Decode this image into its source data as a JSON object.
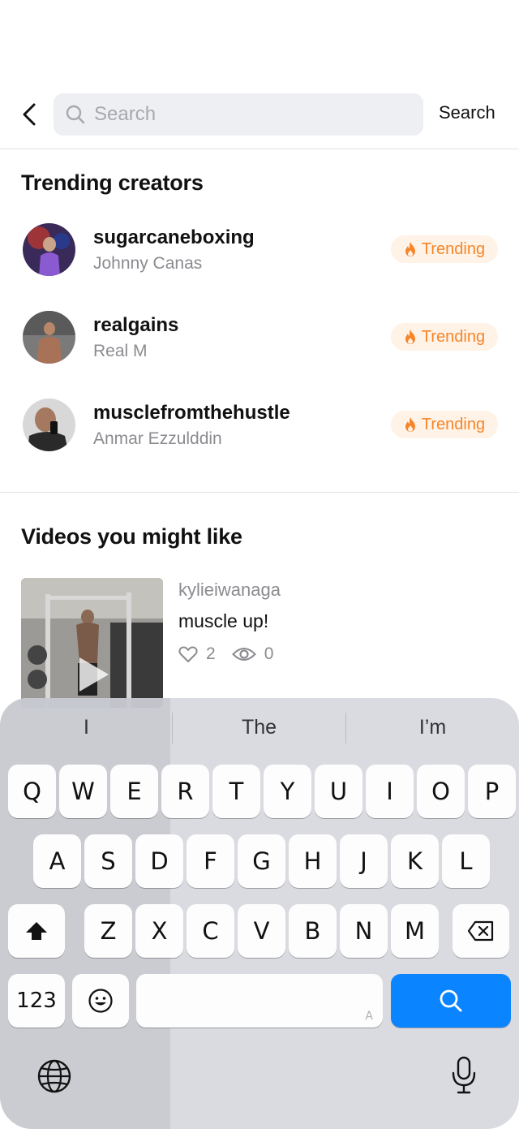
{
  "header": {
    "search_placeholder": "Search",
    "search_action_label": "Search"
  },
  "trending": {
    "title": "Trending creators",
    "badge_label": "Trending",
    "creators": [
      {
        "handle": "sugarcaneboxing",
        "name": "Johnny Canas"
      },
      {
        "handle": "realgains",
        "name": "Real M"
      },
      {
        "handle": "musclefromthehustle",
        "name": "Anmar Ezzulddin"
      }
    ]
  },
  "videos": {
    "title": "Videos you might like",
    "items": [
      {
        "user": "kylieiwanaga",
        "title": "muscle up!",
        "likes": "2",
        "views": "0"
      }
    ]
  },
  "keyboard": {
    "suggestions": [
      "I",
      "The",
      "I’m"
    ],
    "row1": [
      "Q",
      "W",
      "E",
      "R",
      "T",
      "Y",
      "U",
      "I",
      "O",
      "P"
    ],
    "row2": [
      "A",
      "S",
      "D",
      "F",
      "G",
      "H",
      "J",
      "K",
      "L"
    ],
    "row3": [
      "Z",
      "X",
      "C",
      "V",
      "B",
      "N",
      "M"
    ],
    "numbers_label": "123",
    "space_hint": "A",
    "accent_color": "#0a84ff"
  },
  "colors": {
    "trending_text": "#f5862a",
    "trending_bg": "#fff2e6",
    "secondary_text": "#8b8b90"
  }
}
